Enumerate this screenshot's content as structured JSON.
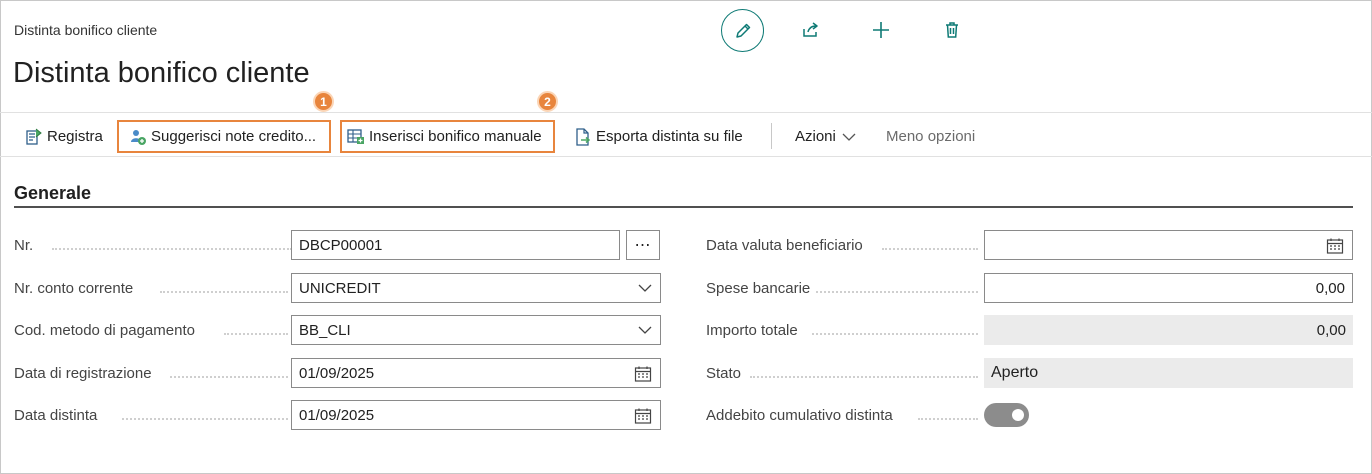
{
  "breadcrumb": "Distinta bonifico cliente",
  "title": "Distinta bonifico cliente",
  "top_actions": {
    "edit_icon": "pencil-icon",
    "share_icon": "share-icon",
    "new_icon": "plus-icon",
    "delete_icon": "trash-icon"
  },
  "actionbar": {
    "registra": "Registra",
    "suggerisci": "Suggerisci note credito...",
    "inserisci": "Inserisci bonifico manuale",
    "esporta": "Esporta distinta su file",
    "azioni": "Azioni",
    "meno_opzioni": "Meno opzioni"
  },
  "badges": {
    "one": "1",
    "two": "2"
  },
  "badge_color": "#e8853d",
  "accent_color": "#0e7a75",
  "section": {
    "title": "Generale"
  },
  "left_fields": {
    "nr": {
      "label": "Nr.",
      "value": "DBCP00001"
    },
    "conto": {
      "label": "Nr. conto corrente",
      "value": "UNICREDIT"
    },
    "metodo": {
      "label": "Cod. metodo di pagamento",
      "value": "BB_CLI"
    },
    "data_reg": {
      "label": "Data di registrazione",
      "value": "01/09/2025"
    },
    "data_distinta": {
      "label": "Data distinta",
      "value": "01/09/2025"
    }
  },
  "right_fields": {
    "data_valuta": {
      "label": "Data valuta beneficiario",
      "value": ""
    },
    "spese": {
      "label": "Spese bancarie",
      "value": "0,00"
    },
    "importo": {
      "label": "Importo totale",
      "value": "0,00"
    },
    "stato": {
      "label": "Stato",
      "value": "Aperto"
    },
    "addebito": {
      "label": "Addebito cumulativo distinta",
      "value": true
    }
  }
}
